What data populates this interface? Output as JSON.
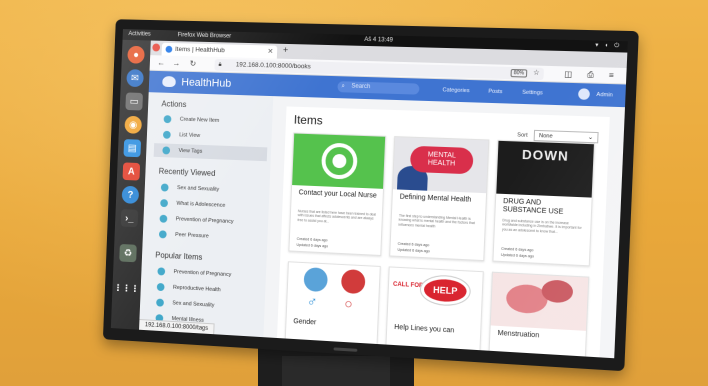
{
  "colors": {
    "header_blue": "#3f74d1",
    "accent_teal": "#3fa7c9",
    "wall_orange": "#e9a83a"
  },
  "topbar": {
    "activities": "Activities",
    "app_name": "Firefox Web Browser",
    "clock": "Aš 4 13:49"
  },
  "browser": {
    "tab_title": "Items | HealthHub",
    "url": "192.168.0.100:8000/books",
    "zoom": "80%",
    "status_url": "192.168.0.100:8000/tags"
  },
  "header": {
    "brand": "HealthHub",
    "search_placeholder": "Search",
    "links": [
      "Categories",
      "Posts",
      "Settings",
      "Admin"
    ]
  },
  "sidebar": {
    "actions_title": "Actions",
    "actions": [
      "Create New Item",
      "List View",
      "View Tags"
    ],
    "recent_title": "Recently Viewed",
    "recent": [
      "Sex and Sexuality",
      "What is Adolescence",
      "Prevention of Pregnancy",
      "Peer Pressure"
    ],
    "popular_title": "Popular Items",
    "popular": [
      "Prevention of Pregnancy",
      "Reproductive Health",
      "Sex and Sexuality",
      "Mental Illness"
    ]
  },
  "main": {
    "title": "Items",
    "sort_label": "Sort",
    "sort_value": "None",
    "cards": [
      {
        "title": "Contact your Local Nurse",
        "image": "whatsapp-logo",
        "desc": "Nurses that are listed here have been trained to deal with issues that affects adolescents and are always free to assist you at...",
        "created": "Created 6 days ago",
        "updated": "Updated 6 days ago"
      },
      {
        "title": "Defining Mental Health",
        "image": "mental-health-cloud",
        "desc": "The first step to understanding Mental Health is knowing what is mental health and the factors that influences mental health",
        "created": "Created 6 days ago",
        "updated": "Updated 6 days ago"
      },
      {
        "title": "DRUG AND SUBSTANCE USE",
        "image": "drugs-down-text",
        "image_text": "DOWN",
        "desc": "Drug and substance use is on the increase worldwide including in Zimbabwe. It is important for you as an adolescent to know that...",
        "created": "Created 6 days ago",
        "updated": "Updated 6 days ago"
      },
      {
        "title": "Gender",
        "image": "gender-avatars"
      },
      {
        "title": "Help Lines you can",
        "image": "help-bubble",
        "image_text_1": "CALL FOR",
        "image_text_2": "HELP"
      },
      {
        "title": "Menstruation",
        "image": "menstruation-illustration"
      }
    ]
  }
}
